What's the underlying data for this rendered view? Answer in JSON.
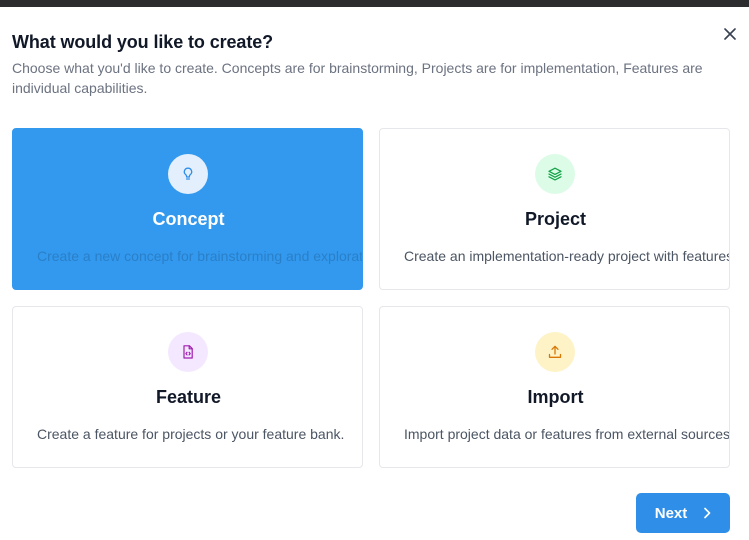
{
  "dialog": {
    "title": "What would you like to create?",
    "subtitle": "Choose what you'd like to create. Concepts are for brainstorming, Projects are for implementation, Features are individual capabilities.",
    "close_icon": "close-icon"
  },
  "options": [
    {
      "title": "Concept",
      "description": "Create a new concept for brainstorming and exploration",
      "icon": "lightbulb-icon",
      "selected": true
    },
    {
      "title": "Project",
      "description": "Create an implementation-ready project with features.",
      "icon": "layers-icon",
      "selected": false
    },
    {
      "title": "Feature",
      "description": "Create a feature for projects or your feature bank.",
      "icon": "file-code-icon",
      "selected": false
    },
    {
      "title": "Import",
      "description": "Import project data or features from external sources.",
      "icon": "upload-icon",
      "selected": false
    }
  ],
  "footer": {
    "next_label": "Next"
  },
  "colors": {
    "accent": "#2f8fe8",
    "selected_card": "#3399ee",
    "project_icon_bg": "#dcfce7",
    "feature_icon_bg": "#f3e8ff",
    "import_icon_bg": "#fef3c7"
  }
}
